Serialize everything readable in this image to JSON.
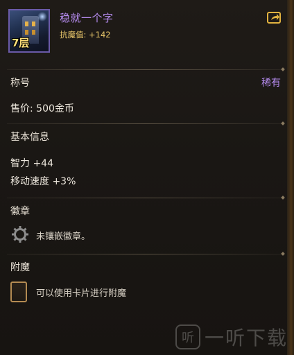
{
  "item": {
    "floor_label": "7层",
    "title": "稳就一个字",
    "resistance_stat": "抗魔值: +142"
  },
  "sections": {
    "title_label": "称号",
    "rarity": "稀有",
    "price": "售价: 500金币",
    "basic_info_label": "基本信息",
    "stats": [
      "智力 +44",
      "移动速度 +3%"
    ],
    "badge_label": "徽章",
    "badge_empty_text": "未镶嵌徽章。",
    "enchant_label": "附魔",
    "enchant_hint": "可以使用卡片进行附魔"
  },
  "watermark": {
    "logo_glyph": "听",
    "text": "一听下载"
  },
  "colors": {
    "title_purple": "#b68cf0",
    "stat_gold": "#e8c66a",
    "accent_gold": "#e2b340"
  },
  "icons": {
    "share": "share-icon",
    "badge_slot": "gear-icon",
    "card_slot": "card-icon"
  }
}
